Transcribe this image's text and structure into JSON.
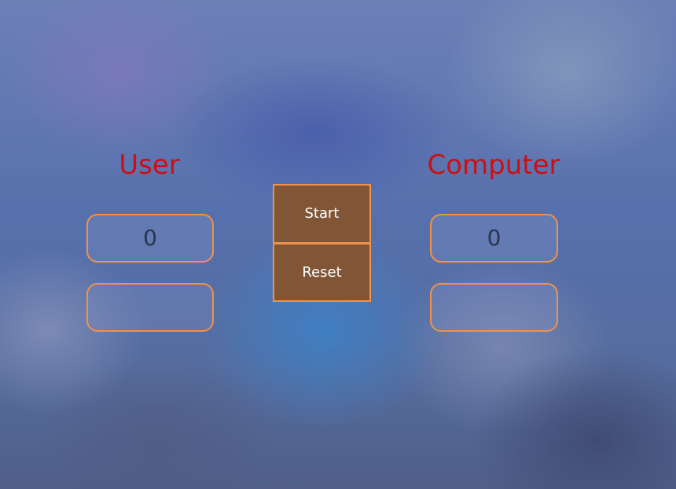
{
  "user": {
    "heading": "User",
    "score": "0",
    "choice": ""
  },
  "computer": {
    "heading": "Computer",
    "score": "0",
    "choice": ""
  },
  "controls": {
    "start_label": "Start",
    "reset_label": "Reset"
  },
  "colors": {
    "heading": "#cc0f12",
    "button_bg": "#815637",
    "accent_border": "#f0924a"
  }
}
